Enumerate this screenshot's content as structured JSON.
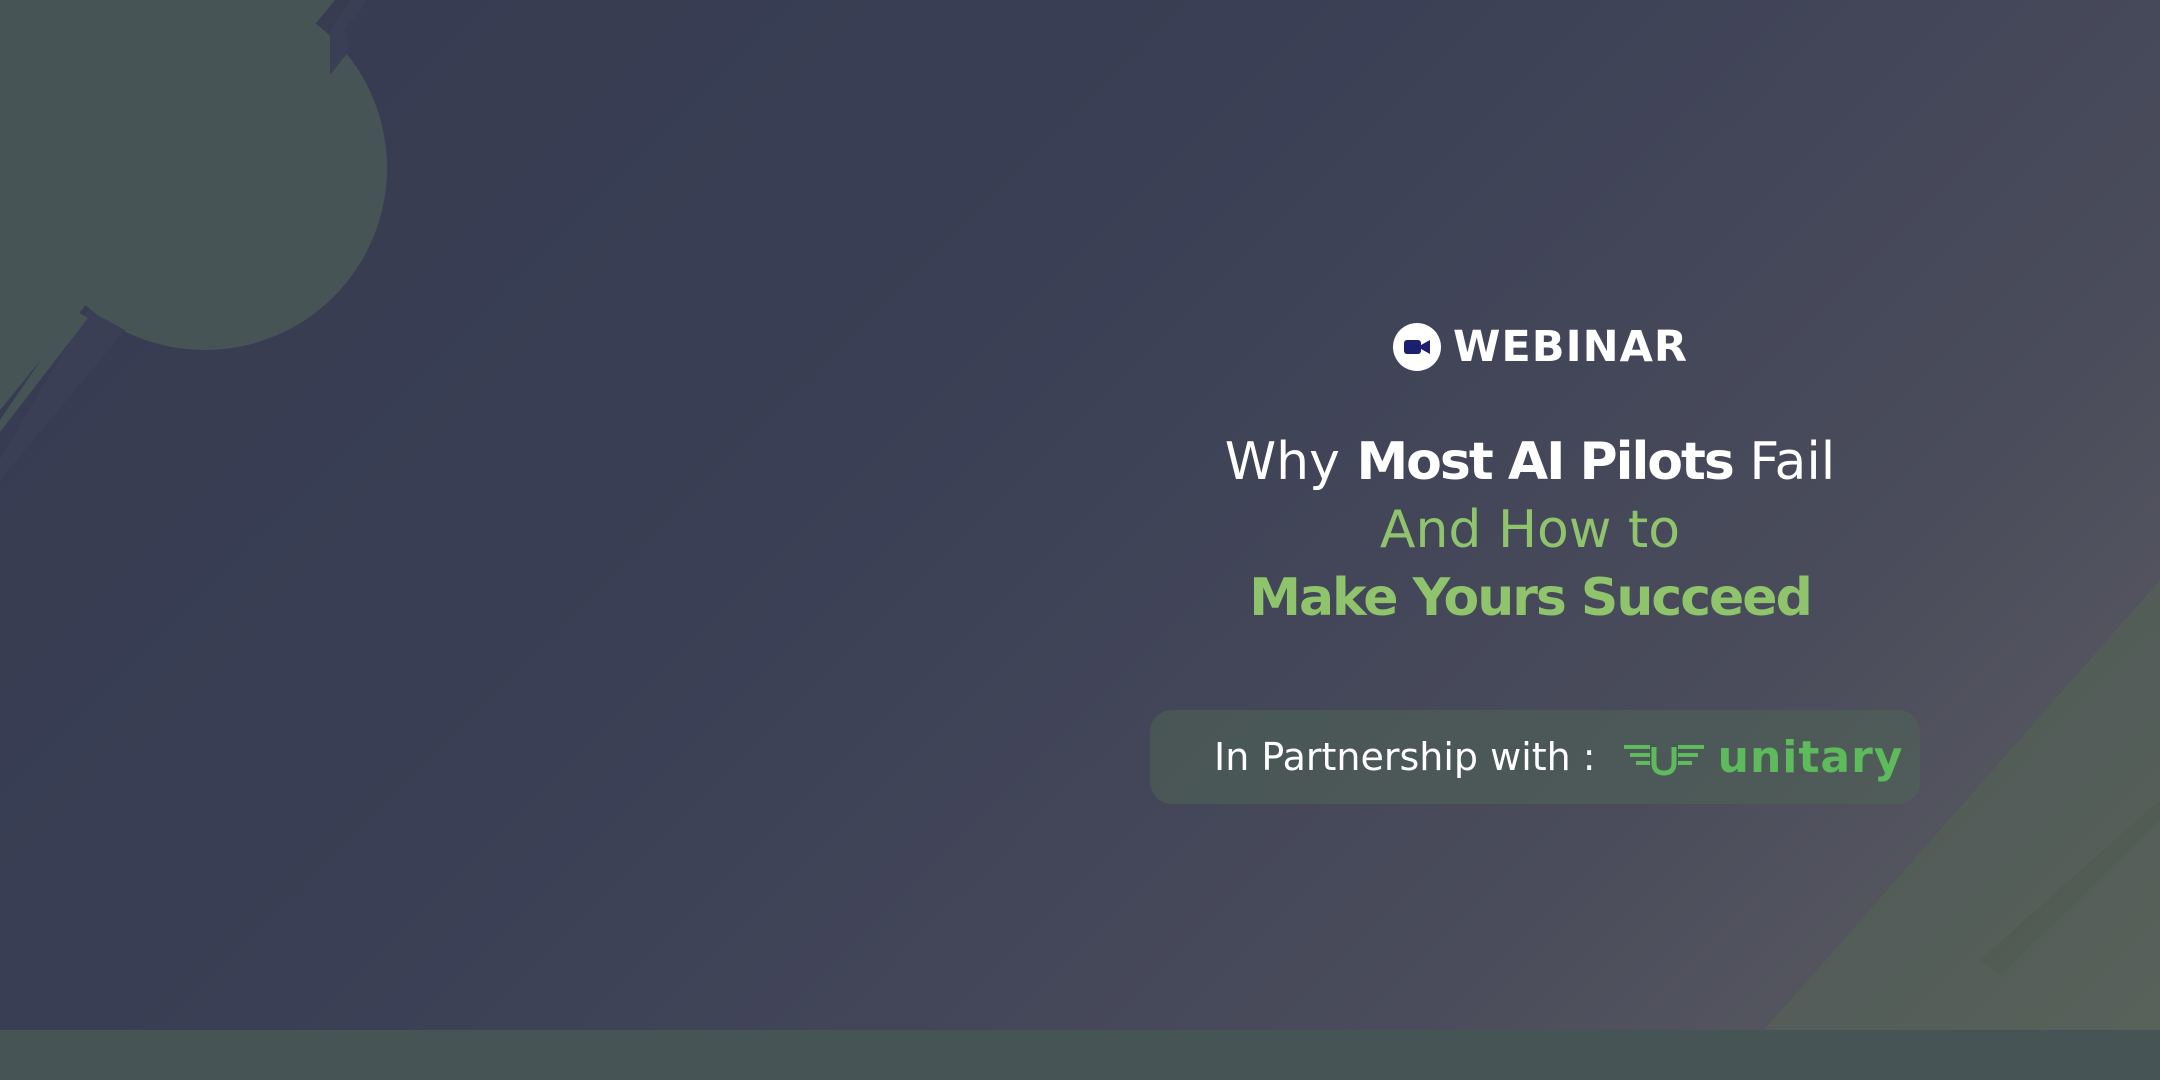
{
  "badge": {
    "label": "WEBINAR",
    "icon": "video-camera-icon"
  },
  "headline": {
    "line1": {
      "part1": "Why ",
      "part2": "Most AI Pilots",
      "part3": " Fail"
    },
    "line2": "And How to",
    "line3": "Make Yours Succeed"
  },
  "partner": {
    "label": "In Partnership with :",
    "logo_text": "unitary",
    "logo_icon": "unitary-wings-logo-icon"
  },
  "colors": {
    "background": "#3a3f55",
    "accent_green": "#8fc46c",
    "logo_green": "#5dbb5c",
    "decor_green": "#465455",
    "text": "#ffffff"
  }
}
